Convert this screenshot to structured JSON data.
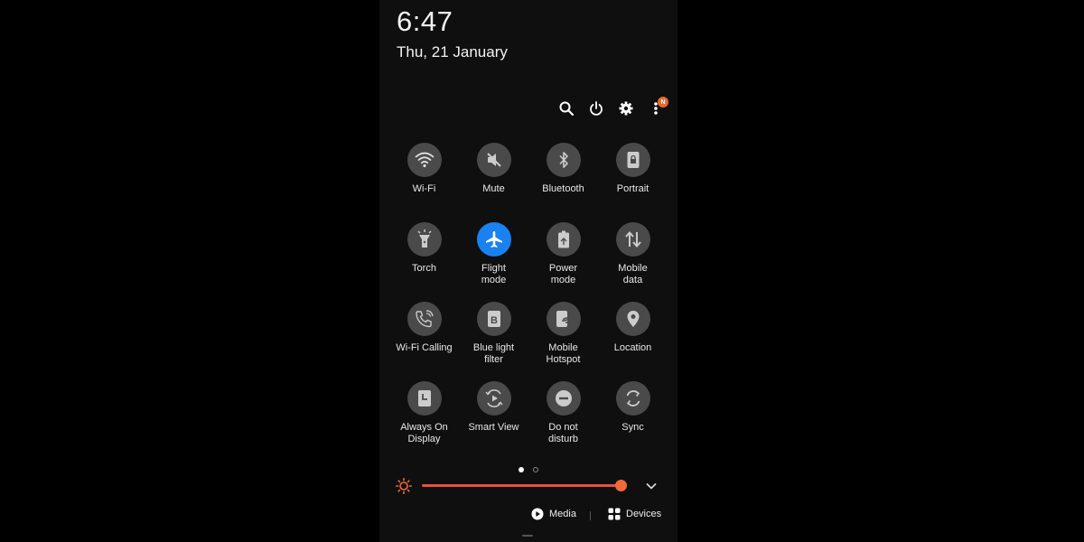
{
  "status": {
    "time": "6:47",
    "date": "Thu, 21 January"
  },
  "header": {
    "notification_badge": "N",
    "badge_color": "#e86a2c"
  },
  "tiles": [
    {
      "label": "Wi-Fi",
      "icon": "wifi-icon",
      "active": false
    },
    {
      "label": "Mute",
      "icon": "mute-icon",
      "active": false
    },
    {
      "label": "Bluetooth",
      "icon": "bluetooth-icon",
      "active": false
    },
    {
      "label": "Portrait",
      "icon": "portrait-lock-icon",
      "active": false
    },
    {
      "label": "Torch",
      "icon": "torch-icon",
      "active": false
    },
    {
      "label": "Flight\nmode",
      "icon": "airplane-icon",
      "active": true
    },
    {
      "label": "Power\nmode",
      "icon": "power-mode-icon",
      "active": false
    },
    {
      "label": "Mobile\ndata",
      "icon": "mobile-data-icon",
      "active": false
    },
    {
      "label": "Wi-Fi Calling",
      "icon": "wifi-calling-icon",
      "active": false
    },
    {
      "label": "Blue light\nfilter",
      "icon": "blue-light-icon",
      "active": false
    },
    {
      "label": "Mobile\nHotspot",
      "icon": "hotspot-icon",
      "active": false
    },
    {
      "label": "Location",
      "icon": "location-icon",
      "active": false
    },
    {
      "label": "Always On\nDisplay",
      "icon": "always-on-display-icon",
      "active": false
    },
    {
      "label": "Smart View",
      "icon": "smart-view-icon",
      "active": false
    },
    {
      "label": "Do not\ndisturb",
      "icon": "do-not-disturb-icon",
      "active": false
    },
    {
      "label": "Sync",
      "icon": "sync-icon",
      "active": false
    }
  ],
  "pagination": {
    "current": 1,
    "total": 2
  },
  "brightness": {
    "level": 0.97,
    "color": "#f06a3c"
  },
  "bottom": {
    "media_label": "Media",
    "devices_label": "Devices"
  },
  "colors": {
    "active_tile": "#1a82f0",
    "inactive_tile": "#4a4a4a"
  }
}
